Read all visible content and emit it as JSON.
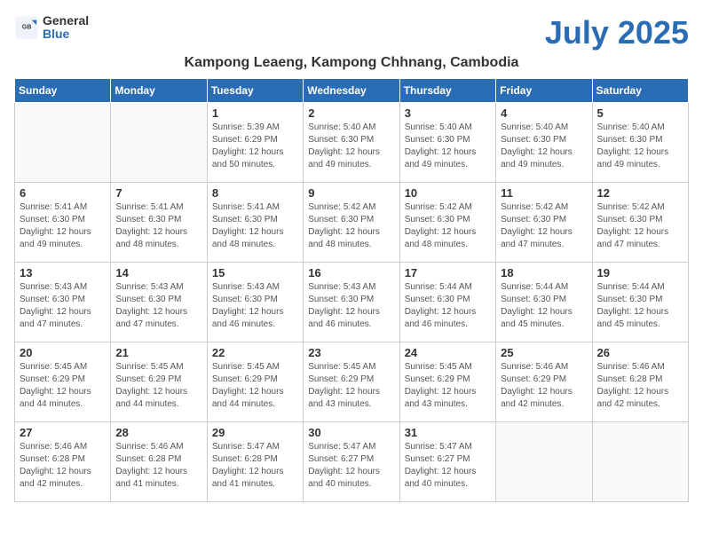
{
  "logo": {
    "general": "General",
    "blue": "Blue"
  },
  "title": "July 2025",
  "location": "Kampong Leaeng, Kampong Chhnang, Cambodia",
  "days_of_week": [
    "Sunday",
    "Monday",
    "Tuesday",
    "Wednesday",
    "Thursday",
    "Friday",
    "Saturday"
  ],
  "weeks": [
    [
      {
        "day": "",
        "info": ""
      },
      {
        "day": "",
        "info": ""
      },
      {
        "day": "1",
        "info": "Sunrise: 5:39 AM\nSunset: 6:29 PM\nDaylight: 12 hours and 50 minutes."
      },
      {
        "day": "2",
        "info": "Sunrise: 5:40 AM\nSunset: 6:30 PM\nDaylight: 12 hours and 49 minutes."
      },
      {
        "day": "3",
        "info": "Sunrise: 5:40 AM\nSunset: 6:30 PM\nDaylight: 12 hours and 49 minutes."
      },
      {
        "day": "4",
        "info": "Sunrise: 5:40 AM\nSunset: 6:30 PM\nDaylight: 12 hours and 49 minutes."
      },
      {
        "day": "5",
        "info": "Sunrise: 5:40 AM\nSunset: 6:30 PM\nDaylight: 12 hours and 49 minutes."
      }
    ],
    [
      {
        "day": "6",
        "info": "Sunrise: 5:41 AM\nSunset: 6:30 PM\nDaylight: 12 hours and 49 minutes."
      },
      {
        "day": "7",
        "info": "Sunrise: 5:41 AM\nSunset: 6:30 PM\nDaylight: 12 hours and 48 minutes."
      },
      {
        "day": "8",
        "info": "Sunrise: 5:41 AM\nSunset: 6:30 PM\nDaylight: 12 hours and 48 minutes."
      },
      {
        "day": "9",
        "info": "Sunrise: 5:42 AM\nSunset: 6:30 PM\nDaylight: 12 hours and 48 minutes."
      },
      {
        "day": "10",
        "info": "Sunrise: 5:42 AM\nSunset: 6:30 PM\nDaylight: 12 hours and 48 minutes."
      },
      {
        "day": "11",
        "info": "Sunrise: 5:42 AM\nSunset: 6:30 PM\nDaylight: 12 hours and 47 minutes."
      },
      {
        "day": "12",
        "info": "Sunrise: 5:42 AM\nSunset: 6:30 PM\nDaylight: 12 hours and 47 minutes."
      }
    ],
    [
      {
        "day": "13",
        "info": "Sunrise: 5:43 AM\nSunset: 6:30 PM\nDaylight: 12 hours and 47 minutes."
      },
      {
        "day": "14",
        "info": "Sunrise: 5:43 AM\nSunset: 6:30 PM\nDaylight: 12 hours and 47 minutes."
      },
      {
        "day": "15",
        "info": "Sunrise: 5:43 AM\nSunset: 6:30 PM\nDaylight: 12 hours and 46 minutes."
      },
      {
        "day": "16",
        "info": "Sunrise: 5:43 AM\nSunset: 6:30 PM\nDaylight: 12 hours and 46 minutes."
      },
      {
        "day": "17",
        "info": "Sunrise: 5:44 AM\nSunset: 6:30 PM\nDaylight: 12 hours and 46 minutes."
      },
      {
        "day": "18",
        "info": "Sunrise: 5:44 AM\nSunset: 6:30 PM\nDaylight: 12 hours and 45 minutes."
      },
      {
        "day": "19",
        "info": "Sunrise: 5:44 AM\nSunset: 6:30 PM\nDaylight: 12 hours and 45 minutes."
      }
    ],
    [
      {
        "day": "20",
        "info": "Sunrise: 5:45 AM\nSunset: 6:29 PM\nDaylight: 12 hours and 44 minutes."
      },
      {
        "day": "21",
        "info": "Sunrise: 5:45 AM\nSunset: 6:29 PM\nDaylight: 12 hours and 44 minutes."
      },
      {
        "day": "22",
        "info": "Sunrise: 5:45 AM\nSunset: 6:29 PM\nDaylight: 12 hours and 44 minutes."
      },
      {
        "day": "23",
        "info": "Sunrise: 5:45 AM\nSunset: 6:29 PM\nDaylight: 12 hours and 43 minutes."
      },
      {
        "day": "24",
        "info": "Sunrise: 5:45 AM\nSunset: 6:29 PM\nDaylight: 12 hours and 43 minutes."
      },
      {
        "day": "25",
        "info": "Sunrise: 5:46 AM\nSunset: 6:29 PM\nDaylight: 12 hours and 42 minutes."
      },
      {
        "day": "26",
        "info": "Sunrise: 5:46 AM\nSunset: 6:28 PM\nDaylight: 12 hours and 42 minutes."
      }
    ],
    [
      {
        "day": "27",
        "info": "Sunrise: 5:46 AM\nSunset: 6:28 PM\nDaylight: 12 hours and 42 minutes."
      },
      {
        "day": "28",
        "info": "Sunrise: 5:46 AM\nSunset: 6:28 PM\nDaylight: 12 hours and 41 minutes."
      },
      {
        "day": "29",
        "info": "Sunrise: 5:47 AM\nSunset: 6:28 PM\nDaylight: 12 hours and 41 minutes."
      },
      {
        "day": "30",
        "info": "Sunrise: 5:47 AM\nSunset: 6:27 PM\nDaylight: 12 hours and 40 minutes."
      },
      {
        "day": "31",
        "info": "Sunrise: 5:47 AM\nSunset: 6:27 PM\nDaylight: 12 hours and 40 minutes."
      },
      {
        "day": "",
        "info": ""
      },
      {
        "day": "",
        "info": ""
      }
    ]
  ]
}
